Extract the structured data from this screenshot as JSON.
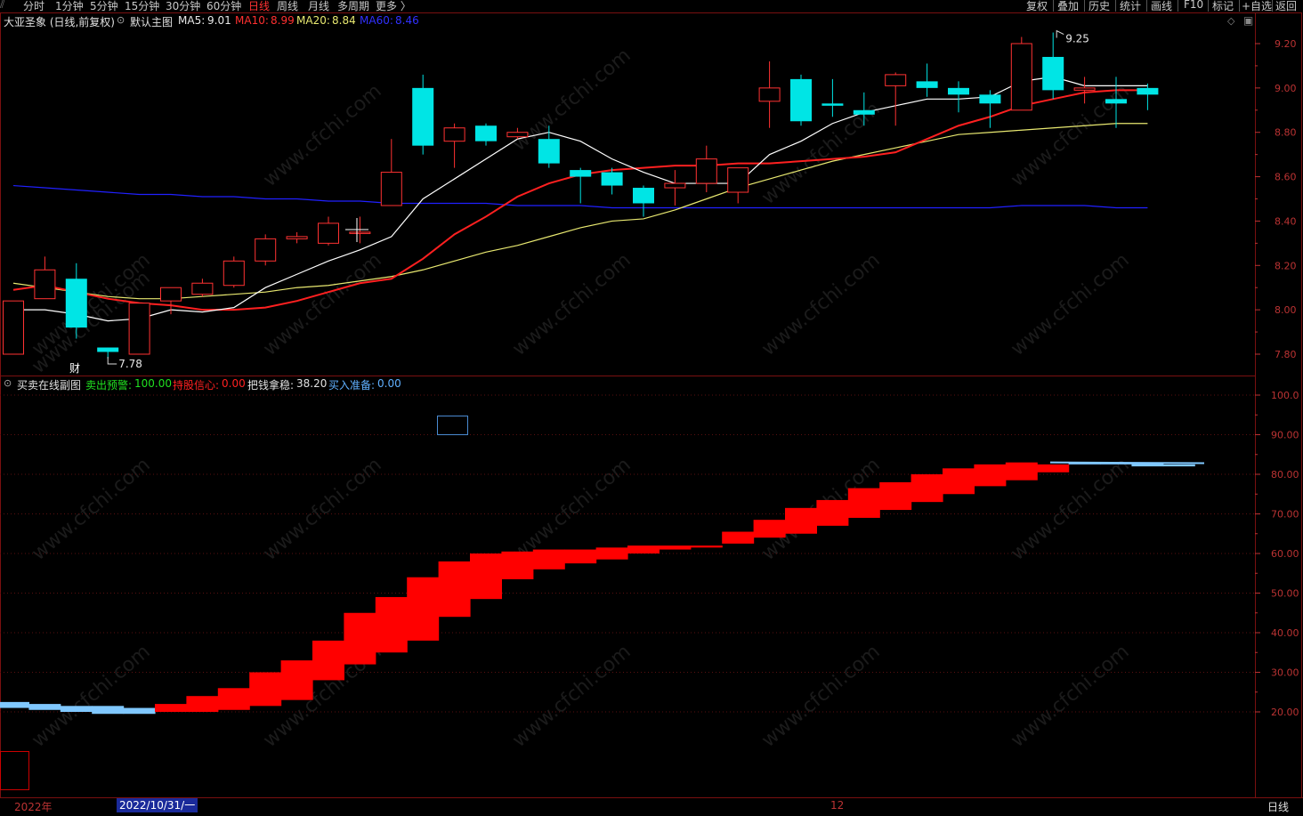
{
  "toolbar": {
    "periods": [
      "分时",
      "1分钟",
      "5分钟",
      "15分钟",
      "30分钟",
      "60分钟",
      "日线",
      "周线",
      "月线",
      "多周期",
      "更多 〉"
    ],
    "active": "日线",
    "right": [
      "复权",
      "叠加",
      "历史",
      "统计",
      "画线",
      "F10",
      "标记",
      "+自选",
      "返回"
    ]
  },
  "main": {
    "stock_title": "大亚圣象 (日线,前复权)",
    "template": "默认主图",
    "ma5_label": "MA5:",
    "ma5_value": "9.01",
    "ma10_label": "MA10:",
    "ma10_value": "8.99",
    "ma20_label": "MA20:",
    "ma20_value": "8.84",
    "ma60_label": "MA60:",
    "ma60_value": "8.46",
    "high_mark": "9.25",
    "low_mark": "7.78",
    "fin_mark": "财",
    "y_ticks": [
      "9.20",
      "9.00",
      "8.80",
      "8.60",
      "8.40",
      "8.20",
      "8.00",
      "7.80"
    ]
  },
  "sub": {
    "title": "买卖在线副图",
    "sell_label": "卖出预警:",
    "sell_value": "100.00",
    "hold_label": "持股信心:",
    "hold_value": "0.00",
    "steady_label": "把钱拿稳:",
    "steady_value": "38.20",
    "buy_label": "买入准备:",
    "buy_value": "0.00",
    "y_ticks": [
      "100.0",
      "90.00",
      "80.00",
      "70.00",
      "60.00",
      "50.00",
      "40.00",
      "30.00",
      "20.00"
    ]
  },
  "bottom": {
    "year": "2022年",
    "cursor_date": "2022/10/31/一",
    "month": "12",
    "period_button": "日线"
  },
  "watermark": "www.cfchi.com",
  "colors": {
    "up": "#ff3232",
    "down": "#00e5e5",
    "ma5": "#ffffff",
    "ma10": "#ff2020",
    "ma20": "#e8e870",
    "ma60": "#2020ff",
    "sub_red": "#ff0000",
    "sub_blue": "#80c8ff"
  },
  "chart_data": {
    "type": "candlestick",
    "candles": [
      {
        "o": 7.8,
        "c": 8.04,
        "h": 8.04,
        "l": 7.8
      },
      {
        "o": 8.05,
        "c": 8.18,
        "h": 8.24,
        "l": 8.05
      },
      {
        "o": 8.14,
        "c": 7.92,
        "h": 8.21,
        "l": 7.87
      },
      {
        "o": 7.83,
        "c": 7.81,
        "h": 7.83,
        "l": 7.78
      },
      {
        "o": 7.8,
        "c": 8.03,
        "h": 8.03,
        "l": 7.8
      },
      {
        "o": 8.04,
        "c": 8.1,
        "h": 8.1,
        "l": 7.98
      },
      {
        "o": 8.07,
        "c": 8.12,
        "h": 8.14,
        "l": 8.06
      },
      {
        "o": 8.11,
        "c": 8.22,
        "h": 8.24,
        "l": 8.1
      },
      {
        "o": 8.22,
        "c": 8.32,
        "h": 8.34,
        "l": 8.2
      },
      {
        "o": 8.32,
        "c": 8.33,
        "h": 8.35,
        "l": 8.3
      },
      {
        "o": 8.3,
        "c": 8.39,
        "h": 8.42,
        "l": 8.29
      },
      {
        "o": 8.35,
        "c": 8.35,
        "h": 8.42,
        "l": 8.3
      },
      {
        "o": 8.47,
        "c": 8.62,
        "h": 8.77,
        "l": 8.47
      },
      {
        "o": 9.0,
        "c": 8.74,
        "h": 9.06,
        "l": 8.7
      },
      {
        "o": 8.76,
        "c": 8.82,
        "h": 8.84,
        "l": 8.64
      },
      {
        "o": 8.83,
        "c": 8.76,
        "h": 8.84,
        "l": 8.74
      },
      {
        "o": 8.78,
        "c": 8.8,
        "h": 8.82,
        "l": 8.77
      },
      {
        "o": 8.77,
        "c": 8.66,
        "h": 8.83,
        "l": 8.64
      },
      {
        "o": 8.63,
        "c": 8.6,
        "h": 8.64,
        "l": 8.48
      },
      {
        "o": 8.62,
        "c": 8.56,
        "h": 8.64,
        "l": 8.52
      },
      {
        "o": 8.55,
        "c": 8.48,
        "h": 8.56,
        "l": 8.42
      },
      {
        "o": 8.55,
        "c": 8.57,
        "h": 8.63,
        "l": 8.47
      },
      {
        "o": 8.57,
        "c": 8.68,
        "h": 8.74,
        "l": 8.53
      },
      {
        "o": 8.53,
        "c": 8.64,
        "h": 8.64,
        "l": 8.48
      },
      {
        "o": 8.94,
        "c": 9.0,
        "h": 9.12,
        "l": 8.82
      },
      {
        "o": 9.04,
        "c": 8.85,
        "h": 9.06,
        "l": 8.83
      },
      {
        "o": 8.93,
        "c": 8.92,
        "h": 9.04,
        "l": 8.87
      },
      {
        "o": 8.9,
        "c": 8.88,
        "h": 8.98,
        "l": 8.83
      },
      {
        "o": 9.01,
        "c": 9.06,
        "h": 9.07,
        "l": 8.83
      },
      {
        "o": 9.03,
        "c": 9.0,
        "h": 9.11,
        "l": 8.96
      },
      {
        "o": 9.0,
        "c": 8.97,
        "h": 9.03,
        "l": 8.89
      },
      {
        "o": 8.97,
        "c": 8.93,
        "h": 8.99,
        "l": 8.82
      },
      {
        "o": 8.9,
        "c": 9.2,
        "h": 9.23,
        "l": 8.9
      },
      {
        "o": 9.14,
        "c": 8.99,
        "h": 9.25,
        "l": 8.95
      },
      {
        "o": 8.99,
        "c": 9.0,
        "h": 9.05,
        "l": 8.93
      },
      {
        "o": 8.95,
        "c": 8.93,
        "h": 9.05,
        "l": 8.82
      },
      {
        "o": 9.0,
        "c": 8.97,
        "h": 9.02,
        "l": 8.9
      }
    ],
    "ma5": [
      8.0,
      8.0,
      7.98,
      7.95,
      7.96,
      8.0,
      7.99,
      8.01,
      8.1,
      8.16,
      8.22,
      8.27,
      8.33,
      8.5,
      8.59,
      8.68,
      8.77,
      8.8,
      8.76,
      8.68,
      8.62,
      8.57,
      8.57,
      8.57,
      8.7,
      8.76,
      8.84,
      8.89,
      8.92,
      8.95,
      8.95,
      8.96,
      9.03,
      9.05,
      9.01,
      9.01,
      9.01
    ],
    "ma10": [
      8.09,
      8.11,
      8.08,
      8.05,
      8.03,
      8.02,
      8.0,
      8.0,
      8.01,
      8.04,
      8.08,
      8.12,
      8.14,
      8.23,
      8.34,
      8.42,
      8.51,
      8.57,
      8.61,
      8.63,
      8.64,
      8.65,
      8.65,
      8.66,
      8.66,
      8.67,
      8.68,
      8.69,
      8.71,
      8.77,
      8.83,
      8.87,
      8.92,
      8.95,
      8.98,
      8.99,
      8.99
    ],
    "ma20": [
      8.12,
      8.1,
      8.08,
      8.06,
      8.05,
      8.05,
      8.06,
      8.07,
      8.08,
      8.1,
      8.11,
      8.13,
      8.15,
      8.18,
      8.22,
      8.26,
      8.29,
      8.33,
      8.37,
      8.4,
      8.41,
      8.45,
      8.5,
      8.55,
      8.59,
      8.63,
      8.67,
      8.7,
      8.73,
      8.76,
      8.79,
      8.8,
      8.81,
      8.82,
      8.83,
      8.84,
      8.84
    ],
    "ma60": [
      8.56,
      8.55,
      8.54,
      8.53,
      8.52,
      8.52,
      8.51,
      8.51,
      8.5,
      8.5,
      8.49,
      8.49,
      8.48,
      8.48,
      8.48,
      8.48,
      8.47,
      8.47,
      8.47,
      8.46,
      8.46,
      8.46,
      8.46,
      8.46,
      8.46,
      8.46,
      8.46,
      8.46,
      8.46,
      8.46,
      8.46,
      8.46,
      8.47,
      8.47,
      8.47,
      8.46,
      8.46
    ],
    "sub_series": {
      "red_top": [
        null,
        null,
        null,
        null,
        null,
        22,
        24,
        26,
        30,
        33,
        38,
        45,
        49,
        54,
        58,
        60,
        60.5,
        61,
        61,
        61.5,
        62,
        62,
        62,
        65.5,
        68.5,
        71.5,
        73.5,
        76.5,
        78,
        80,
        81.5,
        82.5,
        83,
        82.5,
        null,
        null,
        null,
        null
      ],
      "red_bottom": [
        null,
        null,
        null,
        null,
        null,
        20,
        20,
        20.5,
        21.5,
        23,
        28,
        32,
        35,
        38,
        44,
        48.5,
        53.5,
        56,
        57.5,
        58.5,
        60,
        61,
        61.5,
        62.5,
        64,
        65,
        67,
        69,
        71,
        73,
        75,
        77,
        78.5,
        80.5,
        null,
        null,
        null,
        null
      ],
      "blue_top": [
        22.5,
        22,
        21.5,
        21.5,
        21,
        null,
        null,
        null,
        null,
        null,
        null,
        null,
        null,
        null,
        null,
        null,
        null,
        null,
        null,
        null,
        null,
        null,
        null,
        null,
        null,
        null,
        null,
        null,
        null,
        null,
        null,
        null,
        null,
        null,
        83,
        83,
        83,
        82.5
      ],
      "blue_bottom": [
        21,
        20.5,
        20,
        19.5,
        19.5,
        null,
        null,
        null,
        null,
        null,
        null,
        null,
        null,
        null,
        null,
        null,
        null,
        null,
        null,
        null,
        null,
        null,
        null,
        null,
        null,
        null,
        null,
        null,
        null,
        null,
        null,
        null,
        null,
        null,
        82.5,
        82.5,
        82,
        82
      ]
    }
  }
}
